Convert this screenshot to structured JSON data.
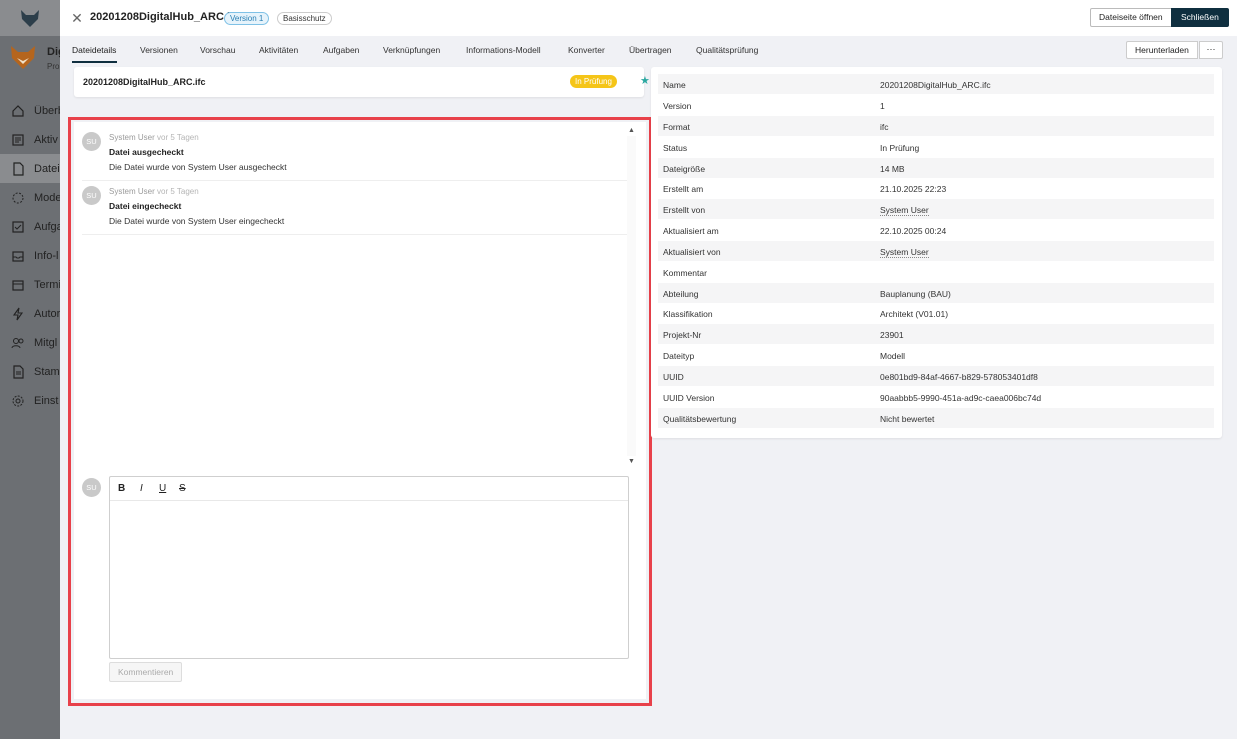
{
  "background_app": {
    "title": "Dig",
    "subtitle": "Pro",
    "nav": [
      {
        "label": "Überb",
        "icon": "home-icon"
      },
      {
        "label": "Aktiv",
        "icon": "activity-icon"
      },
      {
        "label": "Datei",
        "icon": "file-icon",
        "active": true
      },
      {
        "label": "Mode",
        "icon": "model-icon"
      },
      {
        "label": "Aufga",
        "icon": "task-icon"
      },
      {
        "label": "Info-l",
        "icon": "inbox-icon"
      },
      {
        "label": "Termi",
        "icon": "calendar-icon"
      },
      {
        "label": "Autor",
        "icon": "bolt-icon"
      },
      {
        "label": "Mitgl",
        "icon": "users-icon"
      },
      {
        "label": "Stam",
        "icon": "document-icon"
      },
      {
        "label": "Einst",
        "icon": "gear-icon"
      }
    ]
  },
  "header": {
    "file_name": "20201208DigitalHub_ARC.ifc",
    "version_badge": "Version 1",
    "protection_badge": "Basisschutz",
    "open_button": "Dateiseite öffnen",
    "close_button": "Schließen"
  },
  "tabs": [
    {
      "label": "Dateidetails",
      "active": true
    },
    {
      "label": "Versionen"
    },
    {
      "label": "Vorschau"
    },
    {
      "label": "Aktivitäten"
    },
    {
      "label": "Aufgaben"
    },
    {
      "label": "Verknüpfungen"
    },
    {
      "label": "Informations-Modell"
    },
    {
      "label": "Konverter"
    },
    {
      "label": "Übertragen"
    },
    {
      "label": "Qualitätsprüfung"
    }
  ],
  "actions": {
    "download": "Herunterladen",
    "more": "···"
  },
  "file_card": {
    "name": "20201208DigitalHub_ARC.ifc",
    "status": "In Prüfung"
  },
  "comments": {
    "entries": [
      {
        "avatar": "SU",
        "author": "System User",
        "time": "vor 5 Tagen",
        "title": "Datei ausgecheckt",
        "text": "Die Datei wurde von System User ausgecheckt"
      },
      {
        "avatar": "SU",
        "author": "System User",
        "time": "vor 5 Tagen",
        "title": "Datei eingecheckt",
        "text": "Die Datei wurde von System User eingecheckt"
      }
    ],
    "editor_avatar": "SU",
    "toolbar": {
      "bold": "B",
      "italic": "I",
      "underline": "U",
      "strike": "S"
    },
    "submit": "Kommentieren"
  },
  "details": [
    {
      "key": "Name",
      "value": "20201208DigitalHub_ARC.ifc"
    },
    {
      "key": "Version",
      "value": "1"
    },
    {
      "key": "Format",
      "value": "ifc"
    },
    {
      "key": "Status",
      "value": "In Prüfung"
    },
    {
      "key": "Dateigröße",
      "value": "14 MB"
    },
    {
      "key": "Erstellt am",
      "value": "21.10.2025 22:23"
    },
    {
      "key": "Erstellt von",
      "value": "System User",
      "link": true
    },
    {
      "key": "Aktualisiert am",
      "value": "22.10.2025 00:24"
    },
    {
      "key": "Aktualisiert von",
      "value": "System User",
      "link": true
    },
    {
      "key": "Kommentar",
      "value": ""
    },
    {
      "key": "Abteilung",
      "value": "Bauplanung (BAU)"
    },
    {
      "key": "Klassifikation",
      "value": "Architekt (V01.01)"
    },
    {
      "key": "Projekt-Nr",
      "value": "23901"
    },
    {
      "key": "Dateityp",
      "value": "Modell"
    },
    {
      "key": "UUID",
      "value": "0e801bd9-84af-4667-b829-578053401df8"
    },
    {
      "key": "UUID Version",
      "value": "90aabbb5-9990-451a-ad9c-caea006bc74d"
    },
    {
      "key": "Qualitätsbewertung",
      "value": "Nicht bewertet"
    }
  ],
  "colors": {
    "accent_dark": "#0f2f3f",
    "status_yellow": "#f5c518",
    "highlight_red": "#e8414a",
    "star_teal": "#2aa7a0"
  }
}
